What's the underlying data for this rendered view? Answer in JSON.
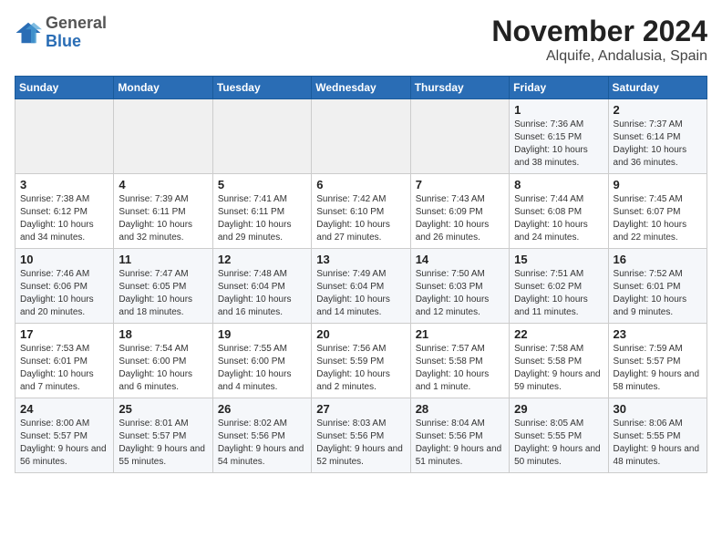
{
  "header": {
    "logo": {
      "general": "General",
      "blue": "Blue"
    },
    "title": "November 2024",
    "subtitle": "Alquife, Andalusia, Spain"
  },
  "weekdays": [
    "Sunday",
    "Monday",
    "Tuesday",
    "Wednesday",
    "Thursday",
    "Friday",
    "Saturday"
  ],
  "weeks": [
    [
      {
        "day": "",
        "info": ""
      },
      {
        "day": "",
        "info": ""
      },
      {
        "day": "",
        "info": ""
      },
      {
        "day": "",
        "info": ""
      },
      {
        "day": "",
        "info": ""
      },
      {
        "day": "1",
        "info": "Sunrise: 7:36 AM\nSunset: 6:15 PM\nDaylight: 10 hours and 38 minutes."
      },
      {
        "day": "2",
        "info": "Sunrise: 7:37 AM\nSunset: 6:14 PM\nDaylight: 10 hours and 36 minutes."
      }
    ],
    [
      {
        "day": "3",
        "info": "Sunrise: 7:38 AM\nSunset: 6:12 PM\nDaylight: 10 hours and 34 minutes."
      },
      {
        "day": "4",
        "info": "Sunrise: 7:39 AM\nSunset: 6:11 PM\nDaylight: 10 hours and 32 minutes."
      },
      {
        "day": "5",
        "info": "Sunrise: 7:41 AM\nSunset: 6:11 PM\nDaylight: 10 hours and 29 minutes."
      },
      {
        "day": "6",
        "info": "Sunrise: 7:42 AM\nSunset: 6:10 PM\nDaylight: 10 hours and 27 minutes."
      },
      {
        "day": "7",
        "info": "Sunrise: 7:43 AM\nSunset: 6:09 PM\nDaylight: 10 hours and 26 minutes."
      },
      {
        "day": "8",
        "info": "Sunrise: 7:44 AM\nSunset: 6:08 PM\nDaylight: 10 hours and 24 minutes."
      },
      {
        "day": "9",
        "info": "Sunrise: 7:45 AM\nSunset: 6:07 PM\nDaylight: 10 hours and 22 minutes."
      }
    ],
    [
      {
        "day": "10",
        "info": "Sunrise: 7:46 AM\nSunset: 6:06 PM\nDaylight: 10 hours and 20 minutes."
      },
      {
        "day": "11",
        "info": "Sunrise: 7:47 AM\nSunset: 6:05 PM\nDaylight: 10 hours and 18 minutes."
      },
      {
        "day": "12",
        "info": "Sunrise: 7:48 AM\nSunset: 6:04 PM\nDaylight: 10 hours and 16 minutes."
      },
      {
        "day": "13",
        "info": "Sunrise: 7:49 AM\nSunset: 6:04 PM\nDaylight: 10 hours and 14 minutes."
      },
      {
        "day": "14",
        "info": "Sunrise: 7:50 AM\nSunset: 6:03 PM\nDaylight: 10 hours and 12 minutes."
      },
      {
        "day": "15",
        "info": "Sunrise: 7:51 AM\nSunset: 6:02 PM\nDaylight: 10 hours and 11 minutes."
      },
      {
        "day": "16",
        "info": "Sunrise: 7:52 AM\nSunset: 6:01 PM\nDaylight: 10 hours and 9 minutes."
      }
    ],
    [
      {
        "day": "17",
        "info": "Sunrise: 7:53 AM\nSunset: 6:01 PM\nDaylight: 10 hours and 7 minutes."
      },
      {
        "day": "18",
        "info": "Sunrise: 7:54 AM\nSunset: 6:00 PM\nDaylight: 10 hours and 6 minutes."
      },
      {
        "day": "19",
        "info": "Sunrise: 7:55 AM\nSunset: 6:00 PM\nDaylight: 10 hours and 4 minutes."
      },
      {
        "day": "20",
        "info": "Sunrise: 7:56 AM\nSunset: 5:59 PM\nDaylight: 10 hours and 2 minutes."
      },
      {
        "day": "21",
        "info": "Sunrise: 7:57 AM\nSunset: 5:58 PM\nDaylight: 10 hours and 1 minute."
      },
      {
        "day": "22",
        "info": "Sunrise: 7:58 AM\nSunset: 5:58 PM\nDaylight: 9 hours and 59 minutes."
      },
      {
        "day": "23",
        "info": "Sunrise: 7:59 AM\nSunset: 5:57 PM\nDaylight: 9 hours and 58 minutes."
      }
    ],
    [
      {
        "day": "24",
        "info": "Sunrise: 8:00 AM\nSunset: 5:57 PM\nDaylight: 9 hours and 56 minutes."
      },
      {
        "day": "25",
        "info": "Sunrise: 8:01 AM\nSunset: 5:57 PM\nDaylight: 9 hours and 55 minutes."
      },
      {
        "day": "26",
        "info": "Sunrise: 8:02 AM\nSunset: 5:56 PM\nDaylight: 9 hours and 54 minutes."
      },
      {
        "day": "27",
        "info": "Sunrise: 8:03 AM\nSunset: 5:56 PM\nDaylight: 9 hours and 52 minutes."
      },
      {
        "day": "28",
        "info": "Sunrise: 8:04 AM\nSunset: 5:56 PM\nDaylight: 9 hours and 51 minutes."
      },
      {
        "day": "29",
        "info": "Sunrise: 8:05 AM\nSunset: 5:55 PM\nDaylight: 9 hours and 50 minutes."
      },
      {
        "day": "30",
        "info": "Sunrise: 8:06 AM\nSunset: 5:55 PM\nDaylight: 9 hours and 48 minutes."
      }
    ]
  ]
}
